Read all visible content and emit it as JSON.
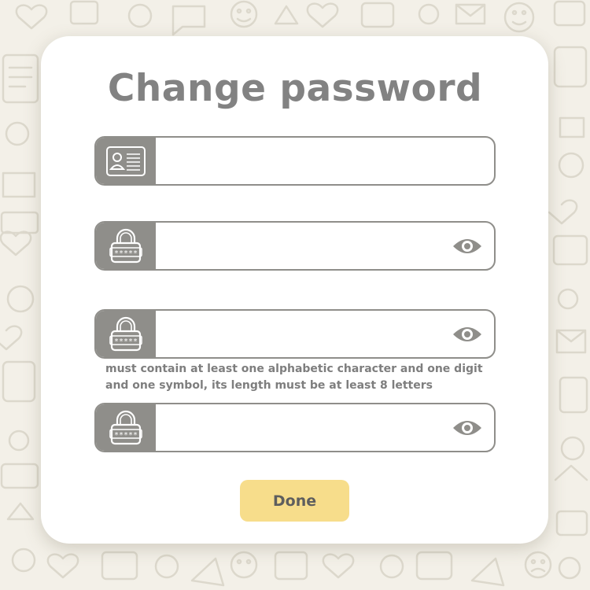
{
  "dialog": {
    "title": "Change password"
  },
  "fields": [
    {
      "icon": "id-card-icon",
      "value": "",
      "placeholder": "",
      "has_visibility_toggle": false
    },
    {
      "icon": "padlock-icon",
      "value": "",
      "placeholder": "",
      "has_visibility_toggle": true
    },
    {
      "icon": "padlock-icon",
      "value": "",
      "placeholder": "",
      "has_visibility_toggle": true
    },
    {
      "icon": "padlock-icon",
      "value": "",
      "placeholder": "",
      "has_visibility_toggle": true
    }
  ],
  "password_hint": "must contain at least one alphabetic character and one digit and one symbol, its length must be at least 8 letters",
  "done_button": {
    "label": "Done"
  },
  "padlock_mask": "*****",
  "colors": {
    "background": "#f3f0e8",
    "card": "#ffffff",
    "field_border": "#8f8e8a",
    "icon_box": "#8f8e8a",
    "title_text": "#828282",
    "button_fill": "#f7dd8b",
    "button_text": "#5e5e5e"
  }
}
